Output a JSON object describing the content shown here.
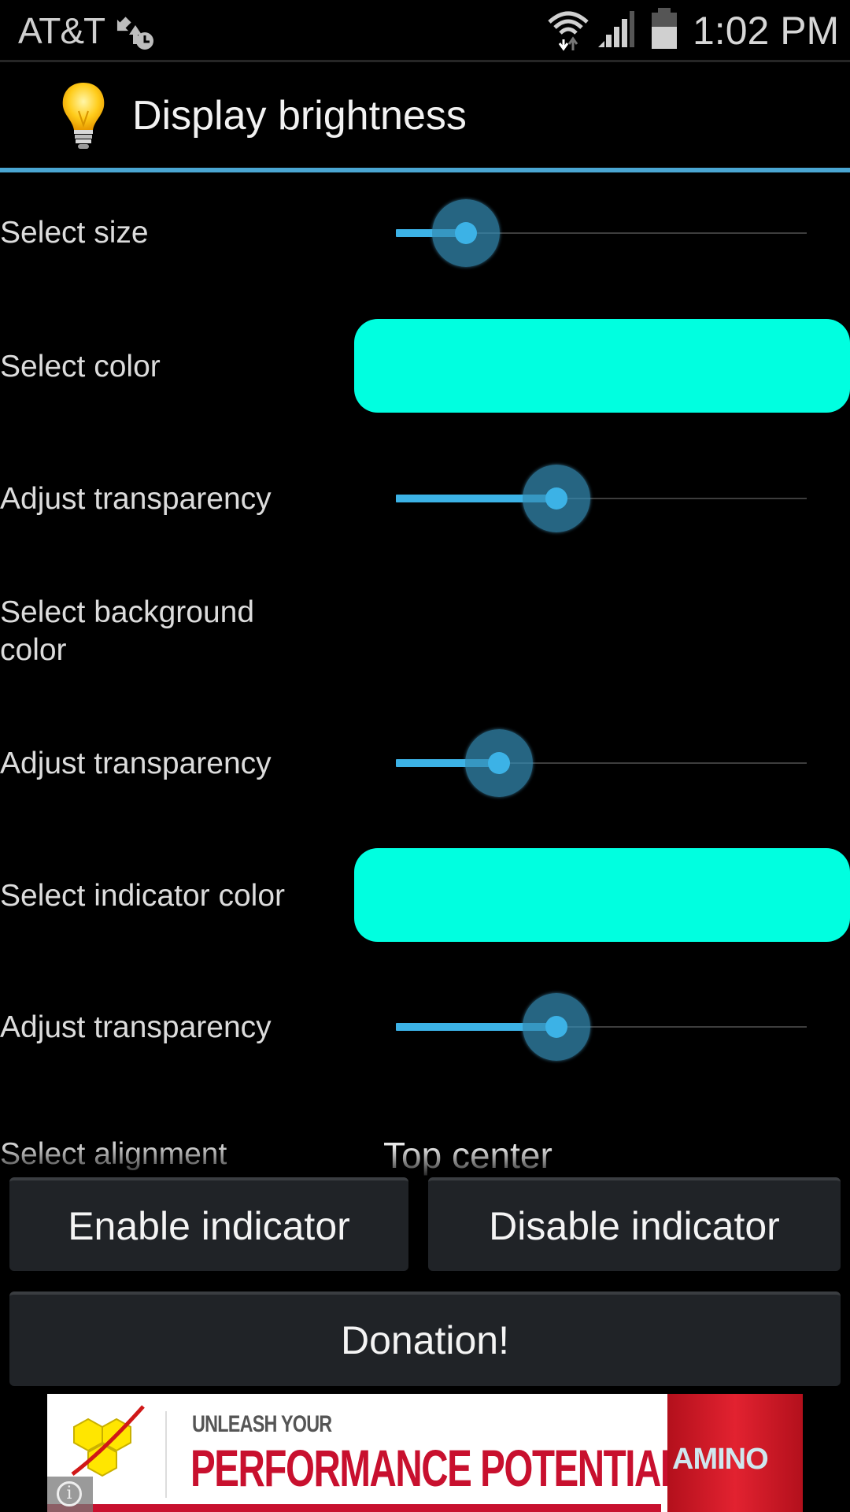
{
  "status_bar": {
    "carrier": "AT&T",
    "time": "1:02 PM",
    "icons": [
      "sync-alarm-icon",
      "wifi-icon",
      "signal-icon",
      "battery-icon"
    ],
    "battery_level": 0.6
  },
  "header": {
    "title": "Display brightness",
    "icon": "lightbulb-icon",
    "accent_color": "#4aa6d3"
  },
  "settings": {
    "size": {
      "label": "Select size",
      "value": 0.17
    },
    "color": {
      "label": "Select color",
      "swatch": "#00ffe0"
    },
    "transparency_1": {
      "label": "Adjust transparency",
      "value": 0.39
    },
    "background_color": {
      "label": "Select background color"
    },
    "transparency_2": {
      "label": "Adjust transparency",
      "value": 0.25
    },
    "indicator_color": {
      "label": "Select indicator color",
      "swatch": "#00ffe0"
    },
    "transparency_3": {
      "label": "Adjust transparency",
      "value": 0.39
    },
    "alignment": {
      "label": "Select alignment",
      "value": "Top center"
    }
  },
  "buttons": {
    "enable": "Enable indicator",
    "disable": "Disable indicator",
    "donation": "Donation!"
  },
  "ad": {
    "line1": "UNLEASH YOUR",
    "line2": "PERFORMANCE POTENTIAL",
    "product": "AMINO",
    "brand_color": "#c8102e",
    "info_icon": "i"
  }
}
